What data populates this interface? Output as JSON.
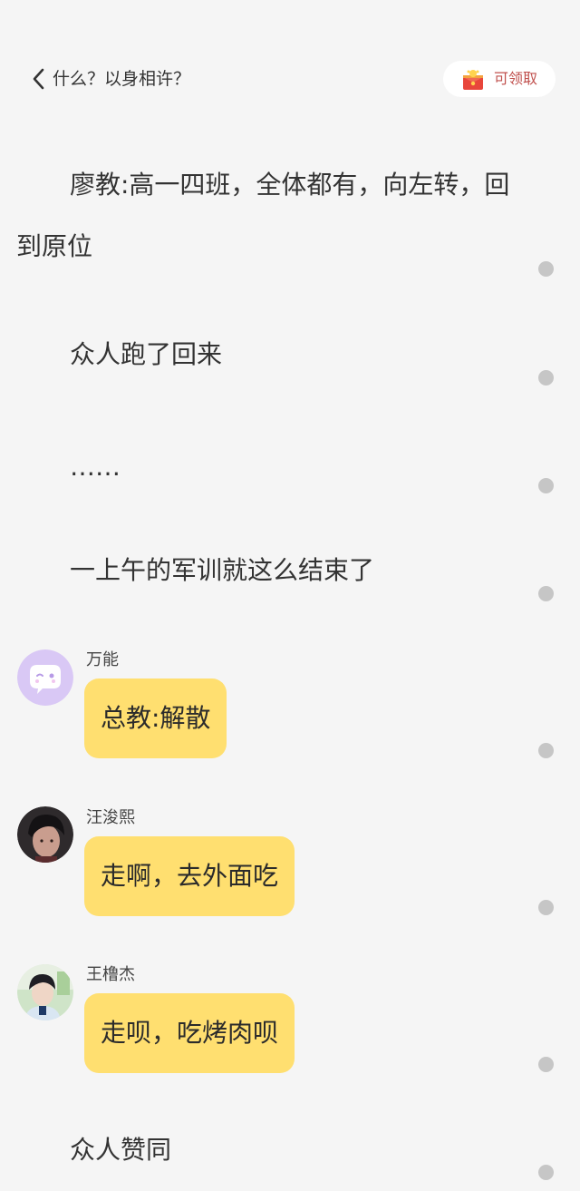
{
  "header": {
    "title": "什么？以身相许？",
    "reward_label": "可领取"
  },
  "narration": [
    "廖教:高一四班，全体都有，向左转，回到原位",
    "众人跑了回来",
    "……",
    "一上午的军训就这么结束了"
  ],
  "messages": [
    {
      "name": "万能",
      "text": "总教:解散"
    },
    {
      "name": "汪浚熙",
      "text": "走啊，去外面吃"
    },
    {
      "name": "王橹杰",
      "text": "走呗，吃烤肉呗"
    }
  ],
  "closing": "众人赞同",
  "colors": {
    "background": "#f5f5f5",
    "bubble": "#ffdf70",
    "reward_text": "#c0504d",
    "dot": "#c6c6c6"
  },
  "icons": [
    "chevron-left-icon",
    "red-envelope-icon",
    "chat-bubble-avatar-icon"
  ]
}
